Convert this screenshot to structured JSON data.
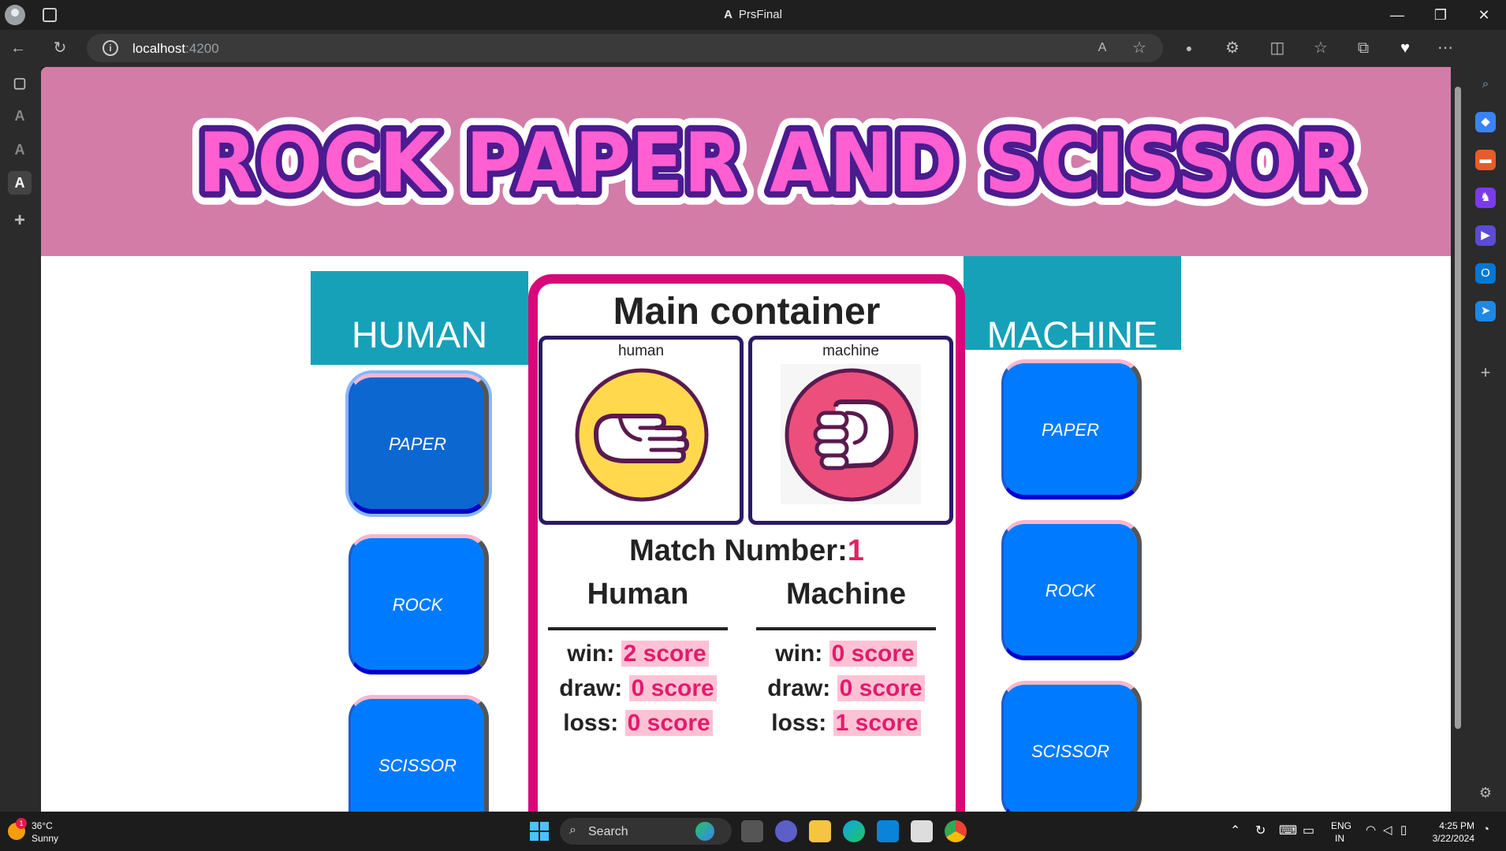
{
  "browser": {
    "window_title": "PrsFinal",
    "url_host": "localhost",
    "url_port": ":4200",
    "buttons": {
      "minimize": "—",
      "restore": "❐",
      "close": "✕"
    }
  },
  "app": {
    "banner_text": "ROCK PAPER AND SCISSOR",
    "human_header": "HUMAN",
    "machine_header": "MACHINE",
    "human_buttons": [
      "PAPER",
      "ROCK",
      "SCISSOR"
    ],
    "human_selected": "PAPER",
    "machine_buttons": [
      "PAPER",
      "ROCK",
      "SCISSOR"
    ],
    "main_title": "Main container",
    "human_choice_label": "human",
    "machine_choice_label": "machine",
    "human_choice_icon": "paper-hand-icon",
    "machine_choice_icon": "rock-fist-icon",
    "match_label": "Match Number:",
    "match_number": "1",
    "human_col_title": "Human",
    "machine_col_title": "Machine",
    "score_labels": {
      "win": "win:",
      "draw": "draw:",
      "loss": "loss:"
    },
    "human_scores": {
      "win": "2 score",
      "draw": "0 score",
      "loss": "0 score"
    },
    "machine_scores": {
      "win": "0 score",
      "draw": "0 score",
      "loss": "1 score"
    }
  },
  "taskbar": {
    "weather_temp": "36°C",
    "weather_desc": "Sunny",
    "weather_badge": "1",
    "search_placeholder": "Search",
    "lang_top": "ENG",
    "lang_bottom": "IN",
    "time": "4:25 PM",
    "date": "3/22/2024"
  },
  "colors": {
    "header_bg": "#d37ca8",
    "side_header_bg": "#17a1b8",
    "button_bg": "#007bff",
    "main_border": "#d6087a",
    "score_highlight": "#ffc2d4"
  }
}
